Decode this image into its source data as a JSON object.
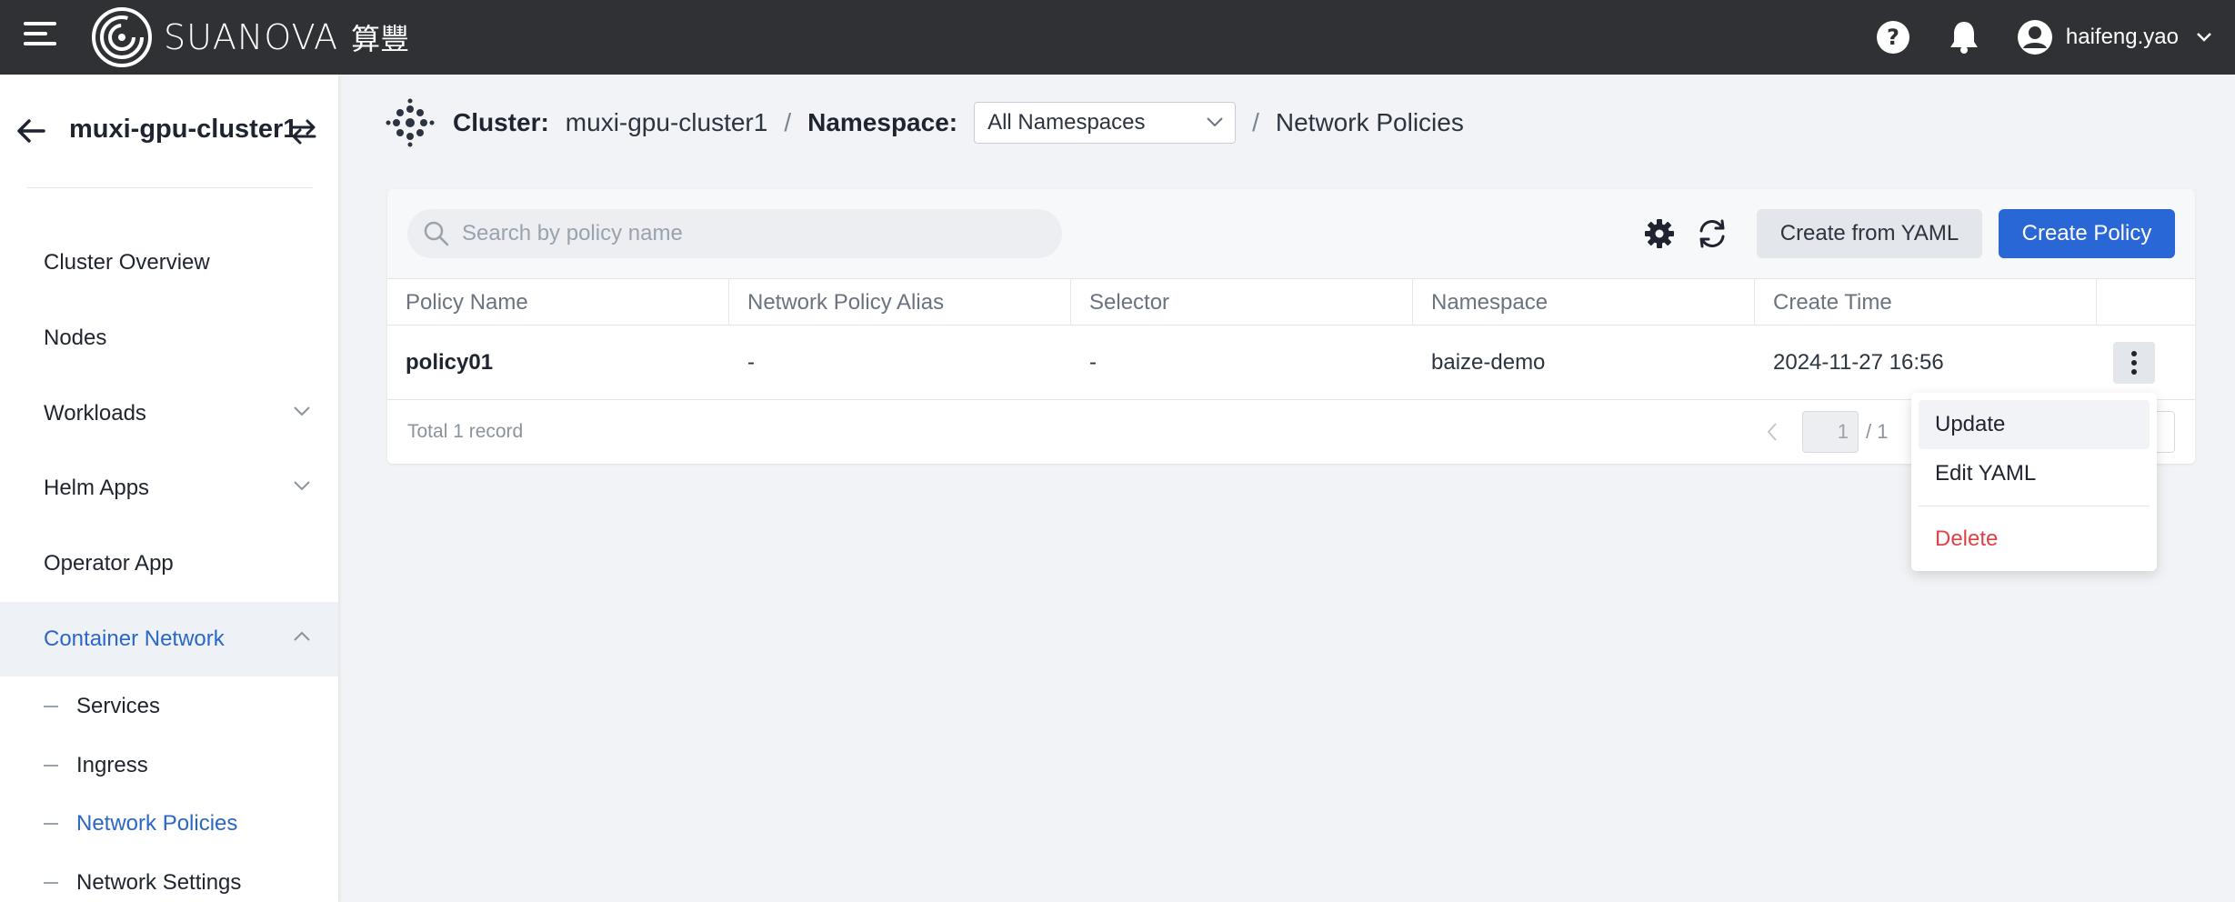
{
  "topbar": {
    "brand_text": "SUANOVA",
    "brand_cn": "算豐",
    "username": "haifeng.yao",
    "icons": [
      "menu-icon",
      "logo-icon",
      "help-icon",
      "bell-icon",
      "user-avatar-icon",
      "chevron-down-icon"
    ]
  },
  "sidebar": {
    "cluster_name": "muxi-gpu-cluster1",
    "items": [
      {
        "label": "Cluster Overview"
      },
      {
        "label": "Nodes"
      },
      {
        "label": "Workloads"
      },
      {
        "label": "Helm Apps"
      },
      {
        "label": "Operator App"
      },
      {
        "label": "Container Network"
      }
    ],
    "sub_items": [
      {
        "label": "Services"
      },
      {
        "label": "Ingress"
      },
      {
        "label": "Network Policies"
      },
      {
        "label": "Network Settings"
      }
    ]
  },
  "breadcrumb": {
    "cluster_label": "Cluster:",
    "cluster_value": "muxi-gpu-cluster1",
    "namespace_label": "Namespace:",
    "namespace_value": "All Namespaces",
    "separator": "/",
    "page": "Network Policies"
  },
  "toolbar": {
    "search_placeholder": "Search by policy name",
    "create_yaml_label": "Create from YAML",
    "create_policy_label": "Create Policy"
  },
  "table": {
    "columns": [
      "Policy Name",
      "Network Policy Alias",
      "Selector",
      "Namespace",
      "Create Time"
    ],
    "rows": [
      {
        "name": "policy01",
        "alias": "-",
        "selector": "-",
        "namespace": "baize-demo",
        "create_time": "2024-11-27 16:56"
      }
    ],
    "total_text": "Total 1 record",
    "page_current": "1",
    "page_total": "/ 1"
  },
  "row_menu": {
    "items": [
      {
        "label": "Update"
      },
      {
        "label": "Edit YAML"
      },
      {
        "label": "Delete"
      }
    ]
  },
  "colors": {
    "topbar": "#2f3135",
    "accent": "#2a67d6",
    "danger": "#e0424a"
  }
}
